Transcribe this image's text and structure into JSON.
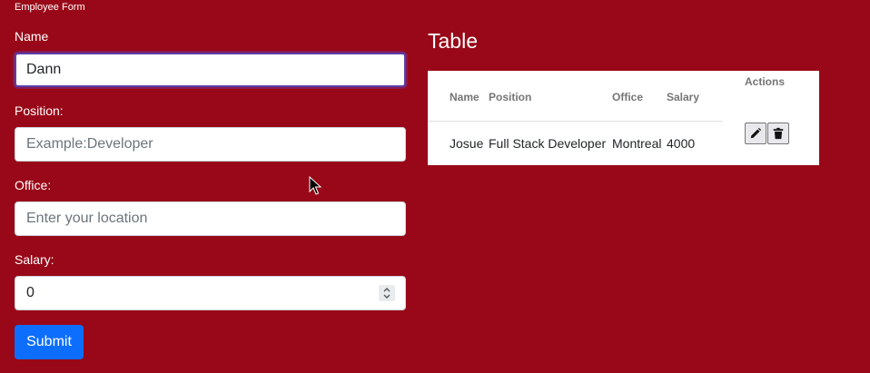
{
  "form": {
    "title": "Employee Form",
    "name_label": "Name",
    "name_value": "Dann",
    "position_label": "Position:",
    "position_placeholder": "Example:Developer",
    "office_label": "Office:",
    "office_placeholder": "Enter your location",
    "salary_label": "Salary:",
    "salary_value": "0",
    "submit_label": "Submit"
  },
  "table": {
    "title": "Table",
    "headers": [
      "Name",
      "Position",
      "Office",
      "Salary"
    ],
    "actions_header": "Actions",
    "rows": [
      {
        "name": "Josue",
        "position": "Full Stack Developer",
        "office": "Montreal",
        "salary": "4000"
      }
    ]
  },
  "icons": {
    "edit": "pencil-icon",
    "delete": "trash-icon",
    "spinner": "chevron-up-down-icon"
  },
  "colors": {
    "background": "#990818",
    "primary": "#0d6efd",
    "focus": "#5a3fa8"
  }
}
